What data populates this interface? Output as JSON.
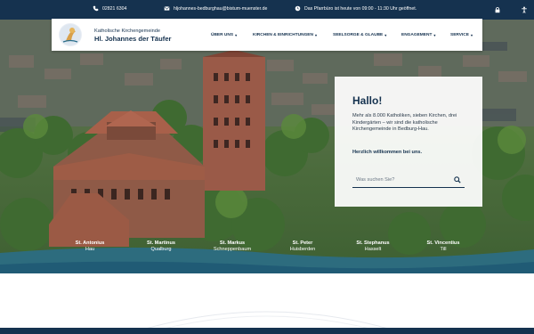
{
  "topbar": {
    "phone": "02821 6304",
    "email": "hljohannes-bedburghau@bistum-muenster.de",
    "office": "Das Pfarrbüro ist heute von 09:00 - 11:30 Uhr geöffnet."
  },
  "header": {
    "brand_small": "Katholische Kirchengemeinde",
    "brand_big": "Hl. Johannes der Täufer",
    "nav": [
      {
        "label": "ÜBER UNS"
      },
      {
        "label": "KIRCHEN & EINRICHTUNGEN"
      },
      {
        "label": "SEELSORGE & GLAUBE"
      },
      {
        "label": "ENGAGEMENT"
      },
      {
        "label": "SERVICE"
      }
    ]
  },
  "card": {
    "title": "Hallo!",
    "text": "Mehr als 8.000 Katholiken, sieben Kirchen, drei Kindergärten – wir sind die katholische Kirchengemeinde in Bedburg-Hau.",
    "welcome": "Herzlich willkommen bei uns.",
    "search_placeholder": "Was suchen Sie?"
  },
  "parishes": [
    {
      "name": "St. Antonius",
      "place": "Hau"
    },
    {
      "name": "St. Martinus",
      "place": "Qualburg"
    },
    {
      "name": "St. Markus",
      "place": "Schneppenbaum"
    },
    {
      "name": "St. Peter",
      "place": "Huisberden"
    },
    {
      "name": "St. Stephanus",
      "place": "Hasselt"
    },
    {
      "name": "St. Vincentius",
      "place": "Till"
    }
  ],
  "icons": {
    "phone": "phone-icon",
    "email": "mail-icon",
    "clock": "clock-icon",
    "lock": "lock-icon",
    "accessibility": "accessibility-icon",
    "search": "search-icon"
  },
  "colors": {
    "navy": "#15324f",
    "wave": "#2a6e8c"
  }
}
